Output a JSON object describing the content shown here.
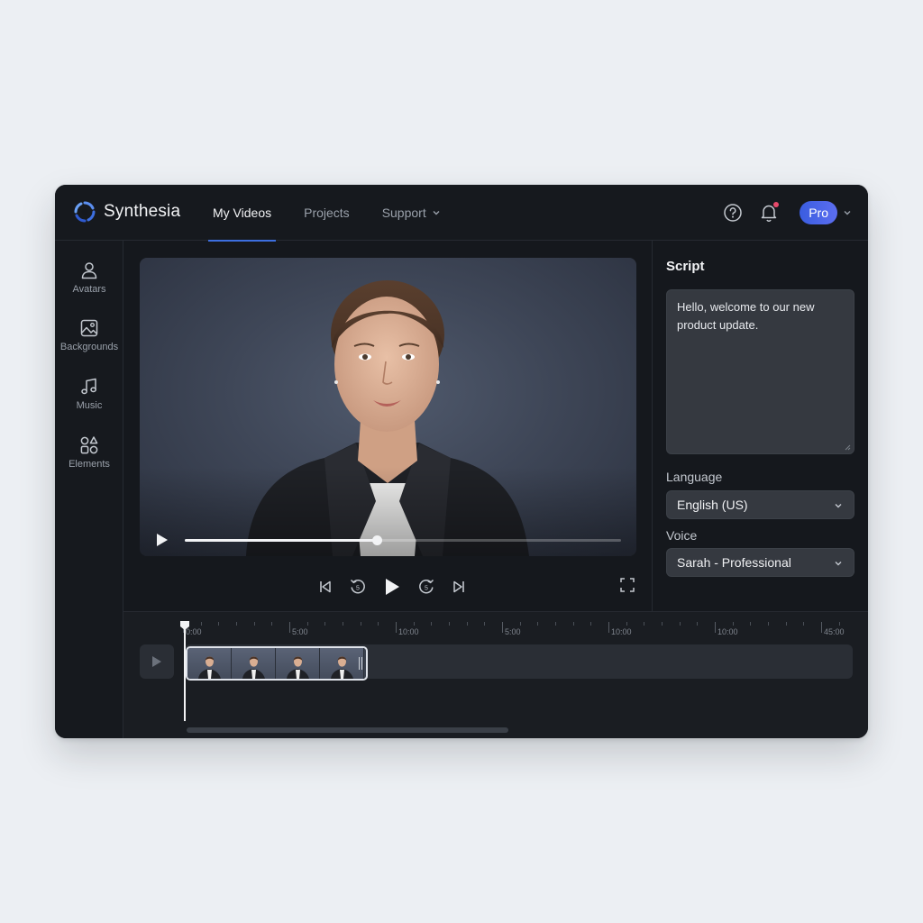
{
  "brand": {
    "name": "Synthesia",
    "accent": "#3d6fe0"
  },
  "nav": {
    "items": [
      {
        "label": "My Videos",
        "active": true
      },
      {
        "label": "Projects",
        "active": false
      },
      {
        "label": "Support",
        "active": false,
        "has_dropdown": true
      }
    ]
  },
  "header": {
    "help_icon": "help-circle-icon",
    "notifications_icon": "bell-icon",
    "has_notification": true,
    "plan_label": "Pro"
  },
  "sidebar": {
    "items": [
      {
        "label": "Avatars",
        "icon": "user-icon"
      },
      {
        "label": "Backgrounds",
        "icon": "image-icon"
      },
      {
        "label": "Music",
        "icon": "music-note-icon"
      },
      {
        "label": "Elements",
        "icon": "shapes-icon"
      }
    ]
  },
  "player": {
    "progress": 0.44,
    "controls": [
      "skip-back-icon",
      "rewind-5-icon",
      "play-icon",
      "forward-5-icon",
      "skip-forward-icon"
    ],
    "fullscreen_icon": "fullscreen-icon"
  },
  "script_panel": {
    "title": "Script",
    "script_text": "Hello, welcome to our new product update.",
    "language_label": "Language",
    "language_value": "English (US)",
    "voice_label": "Voice",
    "voice_value": "Sarah - Professional"
  },
  "timeline": {
    "ruler_labels": [
      "0:00",
      "5:00",
      "10:00",
      "5:00",
      "10:00",
      "10:00",
      "45:00"
    ],
    "clip_thumbnails": 4
  }
}
